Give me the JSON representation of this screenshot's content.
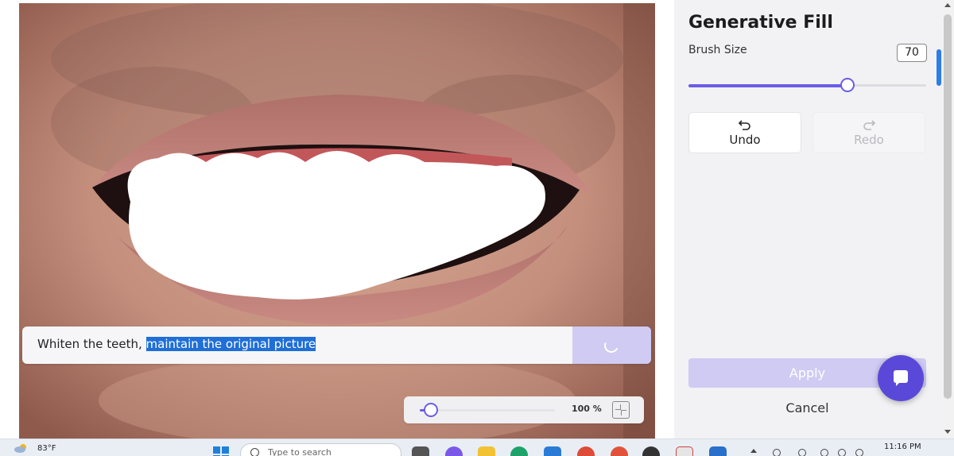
{
  "canvas": {
    "prompt": {
      "text_plain": "Whiten the teeth, ",
      "text_selected": "maintain the original picture"
    },
    "zoom": {
      "level_percent": 0.08,
      "label": "100 %"
    }
  },
  "panel": {
    "title": "Generative Fill",
    "brush_size_label": "Brush Size",
    "brush_size_value": "70",
    "brush_size_fraction": 0.67,
    "undo_label": "Undo",
    "redo_label": "Redo",
    "apply_label": "Apply",
    "cancel_label": "Cancel"
  },
  "colors": {
    "accent": "#6b5ce7",
    "accent_disabled": "#cfcbf3",
    "fab": "#5a49d8",
    "selection": "#1f6fd6"
  },
  "taskbar": {
    "weather_temp": "83°F",
    "search_placeholder": "Type to search",
    "clock_time": "11:16 PM",
    "icons": [
      "weather-icon",
      "windows-start-icon",
      "search-icon",
      "copilot-icon",
      "file-explorer-icon",
      "edge-icon",
      "store-icon",
      "chrome-icon",
      "app-icon",
      "tray-icons"
    ]
  }
}
